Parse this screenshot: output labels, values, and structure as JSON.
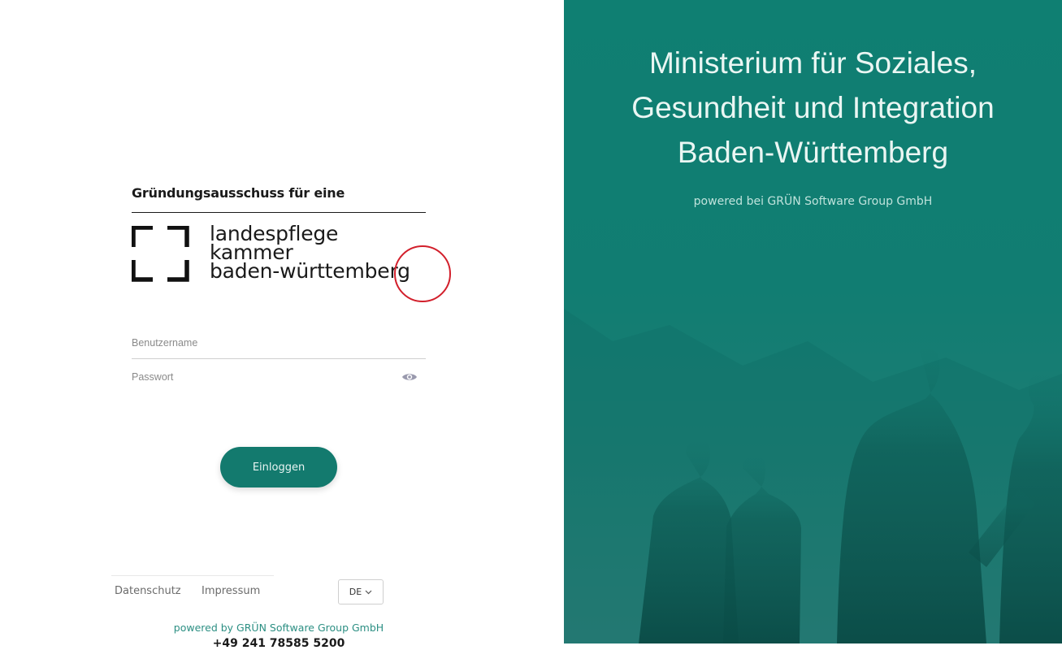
{
  "login": {
    "org_heading": "Gründungsausschuss für eine",
    "brand_lines": [
      "landespflege",
      "kammer",
      "baden-württemberg"
    ],
    "username_placeholder": "Benutzername",
    "password_placeholder": "Passwort",
    "login_button": "Einloggen"
  },
  "footer": {
    "links": [
      "Datenschutz",
      "Impressum"
    ],
    "language": "DE",
    "powered": "powered by GRÜN Software Group GmbH",
    "phone": "+49 241 78585 5200"
  },
  "hero": {
    "title_lines": [
      "Ministerium für Soziales,",
      "Gesundheit und Integration",
      "Baden-Württemberg"
    ],
    "powered": "powered bei GRÜN Software Group GmbH"
  },
  "colors": {
    "accent": "#137a6e",
    "annotation": "#d21f2b"
  },
  "icons": [
    "eye-icon",
    "chevron-down-icon",
    "brand-frame-icon"
  ]
}
